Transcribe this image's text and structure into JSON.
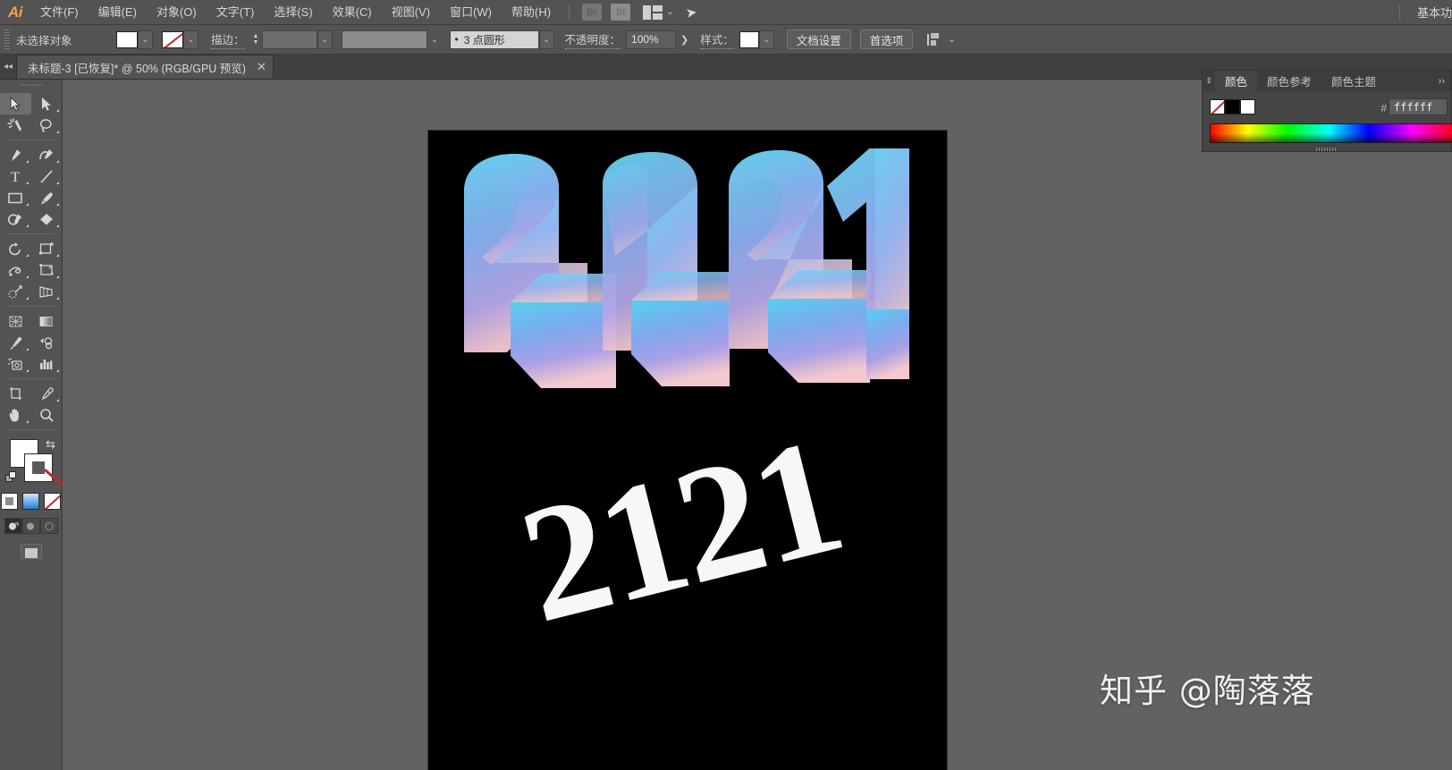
{
  "app": {
    "name": "Adobe Illustrator",
    "logo_text": "Ai",
    "workspace": "基本功"
  },
  "menubar": {
    "items": [
      {
        "label": "文件(F)",
        "name": "menu-file"
      },
      {
        "label": "编辑(E)",
        "name": "menu-edit"
      },
      {
        "label": "对象(O)",
        "name": "menu-object"
      },
      {
        "label": "文字(T)",
        "name": "menu-type"
      },
      {
        "label": "选择(S)",
        "name": "menu-select"
      },
      {
        "label": "效果(C)",
        "name": "menu-effect"
      },
      {
        "label": "视图(V)",
        "name": "menu-view"
      },
      {
        "label": "窗口(W)",
        "name": "menu-window"
      },
      {
        "label": "帮助(H)",
        "name": "menu-help"
      }
    ],
    "bridge_label": "Br",
    "stock_label": "St",
    "chevron": "⌄",
    "rocket_glyph": "➤"
  },
  "controlbar": {
    "selection_status": "未选择对象",
    "fill_color": "#ffffff",
    "stroke_color": "none",
    "stroke_label": "描边：",
    "stroke_weight_value": "",
    "stroke_profile_value": "",
    "brush_definition": "3 点圆形",
    "opacity_label": "不透明度：",
    "opacity_value": "100%",
    "style_label": "样式：",
    "style_swatch": "#ffffff",
    "document_setup_label": "文档设置",
    "preferences_label": "首选项",
    "chevron": "⌄",
    "arrow": "❯"
  },
  "tabbar": {
    "collapse_glyph": "◂◂",
    "document_tab": "未标题-3 [已恢复]* @ 50% (RGB/GPU 预览)",
    "close_glyph": "✕"
  },
  "toolbar": {
    "tools": [
      {
        "name": "selection-tool",
        "label": "选择工具",
        "selected": true
      },
      {
        "name": "direct-selection-tool",
        "label": "直接选择工具",
        "selected": false
      },
      {
        "name": "magic-wand-tool",
        "label": "魔棒工具",
        "selected": false
      },
      {
        "name": "lasso-tool",
        "label": "套索工具",
        "selected": false
      },
      {
        "name": "pen-tool",
        "label": "钢笔工具",
        "selected": false
      },
      {
        "name": "curvature-tool",
        "label": "曲率工具",
        "selected": false
      },
      {
        "name": "type-tool",
        "label": "文字工具",
        "selected": false
      },
      {
        "name": "line-segment-tool",
        "label": "直线段工具",
        "selected": false
      },
      {
        "name": "rectangle-tool",
        "label": "矩形工具",
        "selected": false
      },
      {
        "name": "paintbrush-tool",
        "label": "画笔工具",
        "selected": false
      },
      {
        "name": "shaper-tool",
        "label": "Shaper 工具",
        "selected": false
      },
      {
        "name": "eraser-tool",
        "label": "橡皮擦工具",
        "selected": false
      },
      {
        "name": "rotate-tool",
        "label": "旋转工具",
        "selected": false
      },
      {
        "name": "scale-tool",
        "label": "比例缩放工具",
        "selected": false
      },
      {
        "name": "width-tool",
        "label": "宽度工具",
        "selected": false
      },
      {
        "name": "free-transform-tool",
        "label": "自由变换工具",
        "selected": false
      },
      {
        "name": "shape-builder-tool",
        "label": "形状生成器工具",
        "selected": false
      },
      {
        "name": "perspective-grid-tool",
        "label": "透视网格工具",
        "selected": false
      },
      {
        "name": "mesh-tool",
        "label": "网格工具",
        "selected": false
      },
      {
        "name": "gradient-tool",
        "label": "渐变工具",
        "selected": false
      },
      {
        "name": "eyedropper-tool",
        "label": "吸管工具",
        "selected": false
      },
      {
        "name": "blend-tool",
        "label": "混合工具",
        "selected": false
      },
      {
        "name": "symbol-sprayer-tool",
        "label": "符号喷枪工具",
        "selected": false
      },
      {
        "name": "column-graph-tool",
        "label": "柱形图工具",
        "selected": false
      },
      {
        "name": "artboard-tool",
        "label": "画板工具",
        "selected": false
      },
      {
        "name": "slice-tool",
        "label": "切片工具",
        "selected": false
      },
      {
        "name": "hand-tool",
        "label": "抓手工具",
        "selected": false
      },
      {
        "name": "zoom-tool",
        "label": "缩放工具",
        "selected": false
      }
    ],
    "fill_color": "#ffffff",
    "stroke_color": "none",
    "color_mode_buttons": [
      "color",
      "gradient",
      "none"
    ],
    "draw_modes": [
      "draw-normal",
      "draw-behind",
      "draw-inside"
    ],
    "screen_mode": "正常屏幕模式"
  },
  "canvas": {
    "background_color": "#626262",
    "artboard_color": "#000000",
    "zoom_level": "50%"
  },
  "artwork": {
    "headline_text": "2121",
    "extruded_text": "2121",
    "gradient_top": "#5ad0ee",
    "gradient_mid": "#8fa2ea",
    "gradient_bottom": "#f3c7cf",
    "flat_text_color": "#f7f7f7",
    "flat_text_rotation": "-14deg"
  },
  "watermark": {
    "text": "知乎 @陶落落"
  },
  "color_panel": {
    "tabs": [
      {
        "label": "颜色",
        "active": true
      },
      {
        "label": "颜色参考",
        "active": false
      },
      {
        "label": "颜色主题",
        "active": false
      }
    ],
    "grip_glyph": "⇕",
    "collapse_glyph": "››",
    "hash_label": "#",
    "hex_value": "ffffff",
    "swatch_none": "none",
    "swatch_black": "#000000",
    "swatch_white": "#ffffff"
  }
}
